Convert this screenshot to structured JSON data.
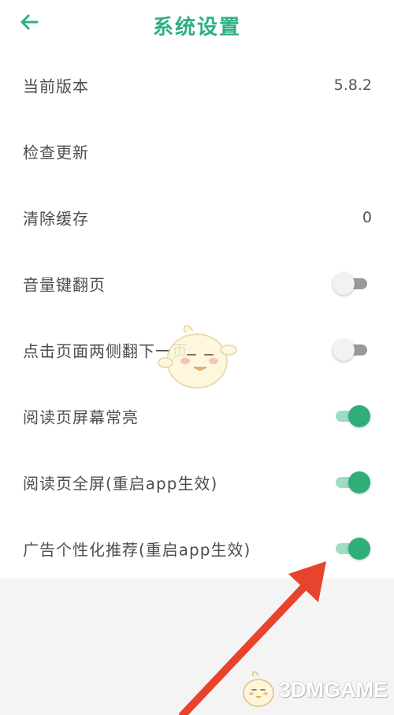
{
  "header": {
    "title": "系统设置",
    "back_icon": "arrow-left-icon"
  },
  "settings": [
    {
      "key": "version",
      "label": "当前版本",
      "value": "5.8.2"
    },
    {
      "key": "check-update",
      "label": "检查更新"
    },
    {
      "key": "clear-cache",
      "label": "清除缓存",
      "value": "0"
    },
    {
      "key": "volume-key-page",
      "label": "音量键翻页",
      "toggle": false
    },
    {
      "key": "tap-sides-next-page",
      "label": "点击页面两侧翻下一页",
      "toggle": false
    },
    {
      "key": "screen-always-on",
      "label": "阅读页屏幕常亮",
      "toggle": true
    },
    {
      "key": "reading-fullscreen",
      "label": "阅读页全屏(重启app生效)",
      "toggle": true
    },
    {
      "key": "personalized-ads",
      "label": "广告个性化推荐(重启app生效)",
      "toggle": true
    }
  ],
  "watermark": {
    "text": "3DMGAME"
  },
  "colors": {
    "accent": "#2fae85",
    "toggle_on_knob": "#2fae7a",
    "toggle_on_track": "#9fdcc4",
    "toggle_off_track": "#9a9a9a",
    "arrow": "#e8432c"
  }
}
